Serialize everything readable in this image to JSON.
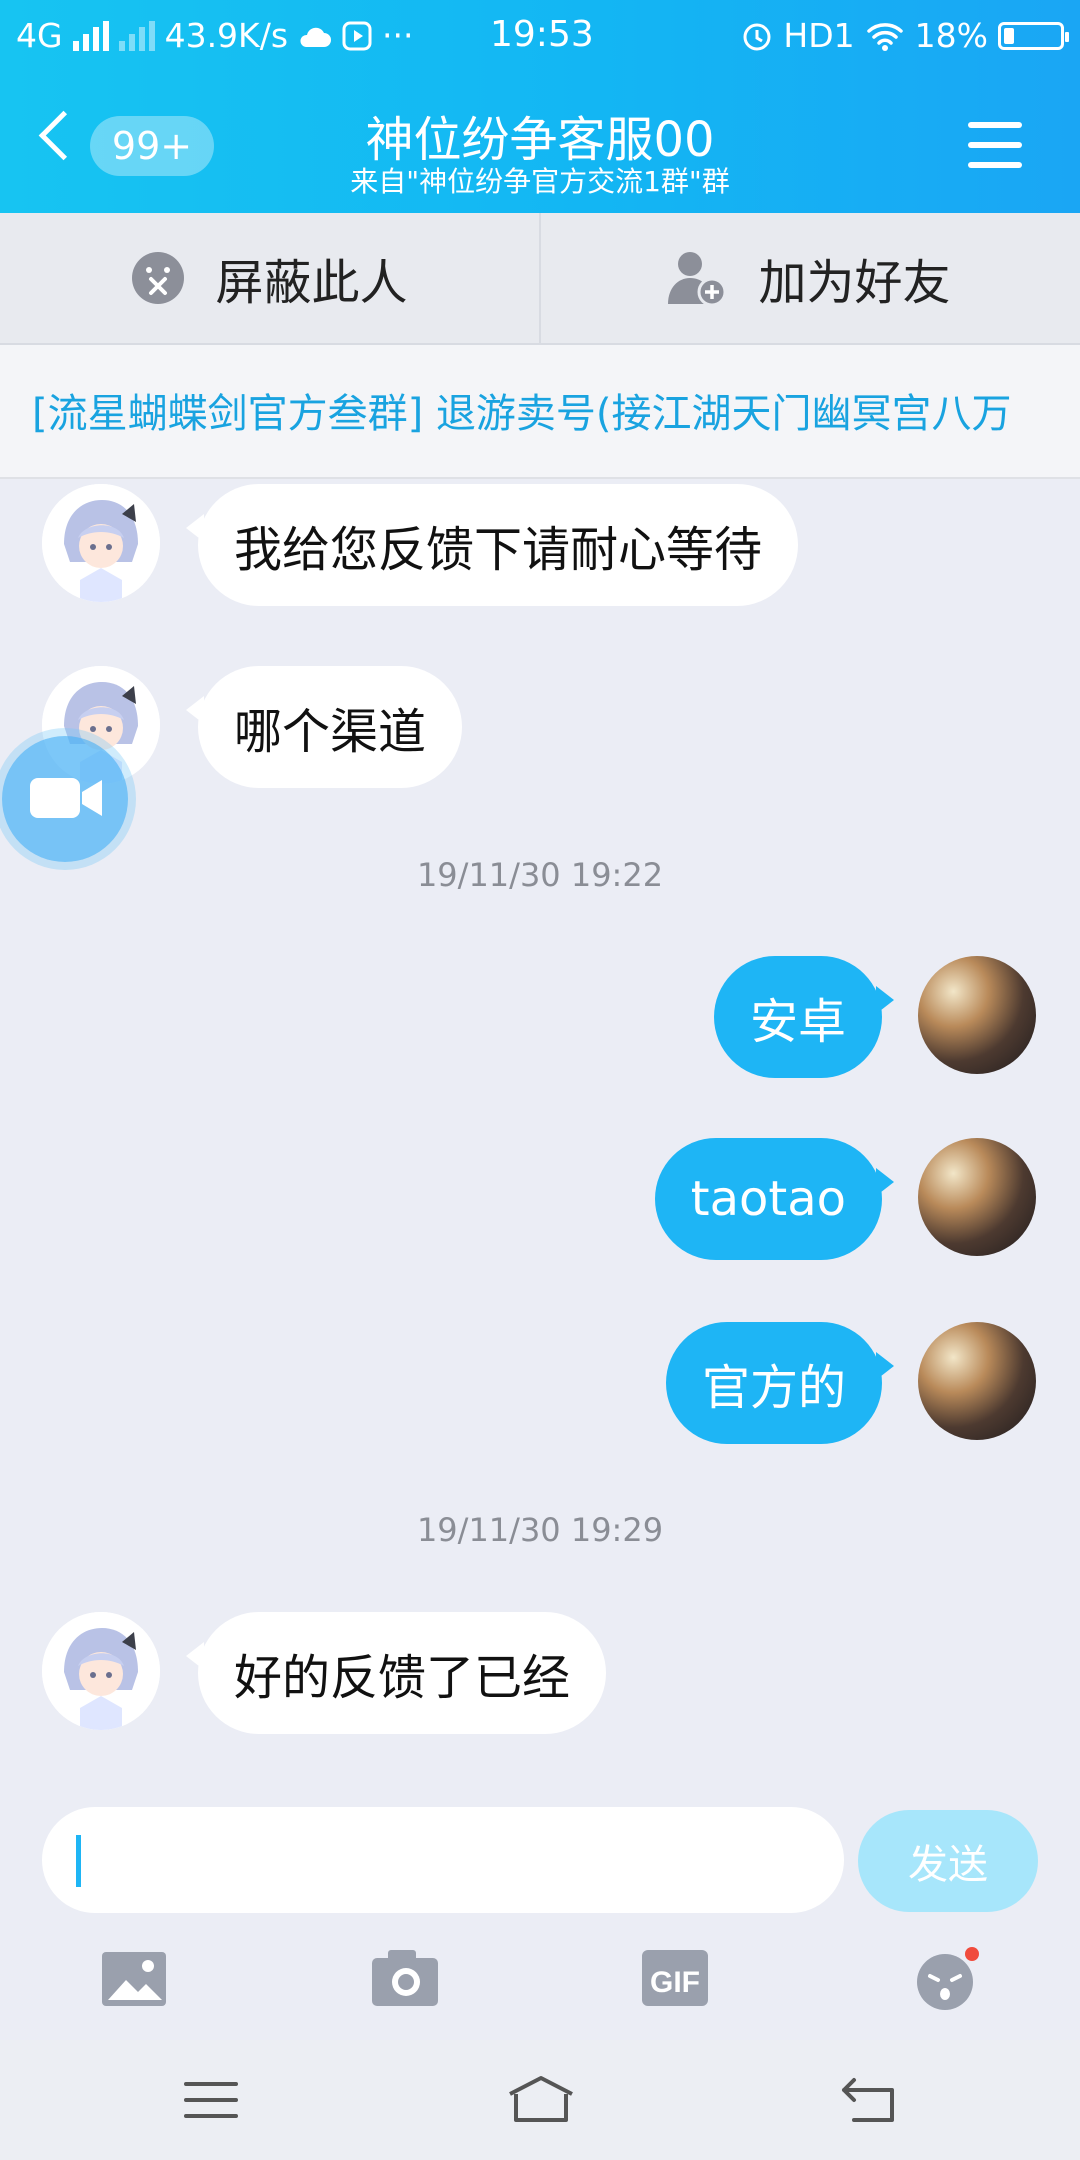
{
  "status_bar": {
    "network": "4G",
    "speed": "43.9K/s",
    "more": "···",
    "time": "19:53",
    "hd": "HD1",
    "battery": "18%"
  },
  "header": {
    "badge": "99+",
    "title": "神位纷争客服00",
    "subtitle": "来自\"神位纷争官方交流1群\"群"
  },
  "actions": {
    "block": "屏蔽此人",
    "add_friend": "加为好友"
  },
  "banner": {
    "text": "[流星蝴蝶剑官方叁群] 退游卖号(接江湖天门幽冥宫八万"
  },
  "messages": [
    {
      "side": "in",
      "text": "我给您反馈下请耐心等待"
    },
    {
      "side": "in",
      "text": "哪个渠道"
    },
    {
      "timestamp": "19/11/30 19:22"
    },
    {
      "side": "out",
      "text": "安卓"
    },
    {
      "side": "out",
      "text": "taotao"
    },
    {
      "side": "out",
      "text": "官方的"
    },
    {
      "timestamp": "19/11/30 19:29"
    },
    {
      "side": "in",
      "text": "好的反馈了已经"
    }
  ],
  "composer": {
    "send_label": "发送",
    "input_value": ""
  },
  "colors": {
    "accent": "#1eb5f5",
    "header_gradient": [
      "#17c4f2",
      "#1aa6f4"
    ],
    "background": "#ebedf5"
  },
  "icons": [
    "back-icon",
    "hamburger-menu-icon",
    "block-face-icon",
    "add-friend-icon",
    "video-call-icon",
    "image-icon",
    "camera-icon",
    "gif-icon",
    "emoji-icon",
    "nav-menu-icon",
    "nav-home-icon",
    "nav-back-icon"
  ]
}
